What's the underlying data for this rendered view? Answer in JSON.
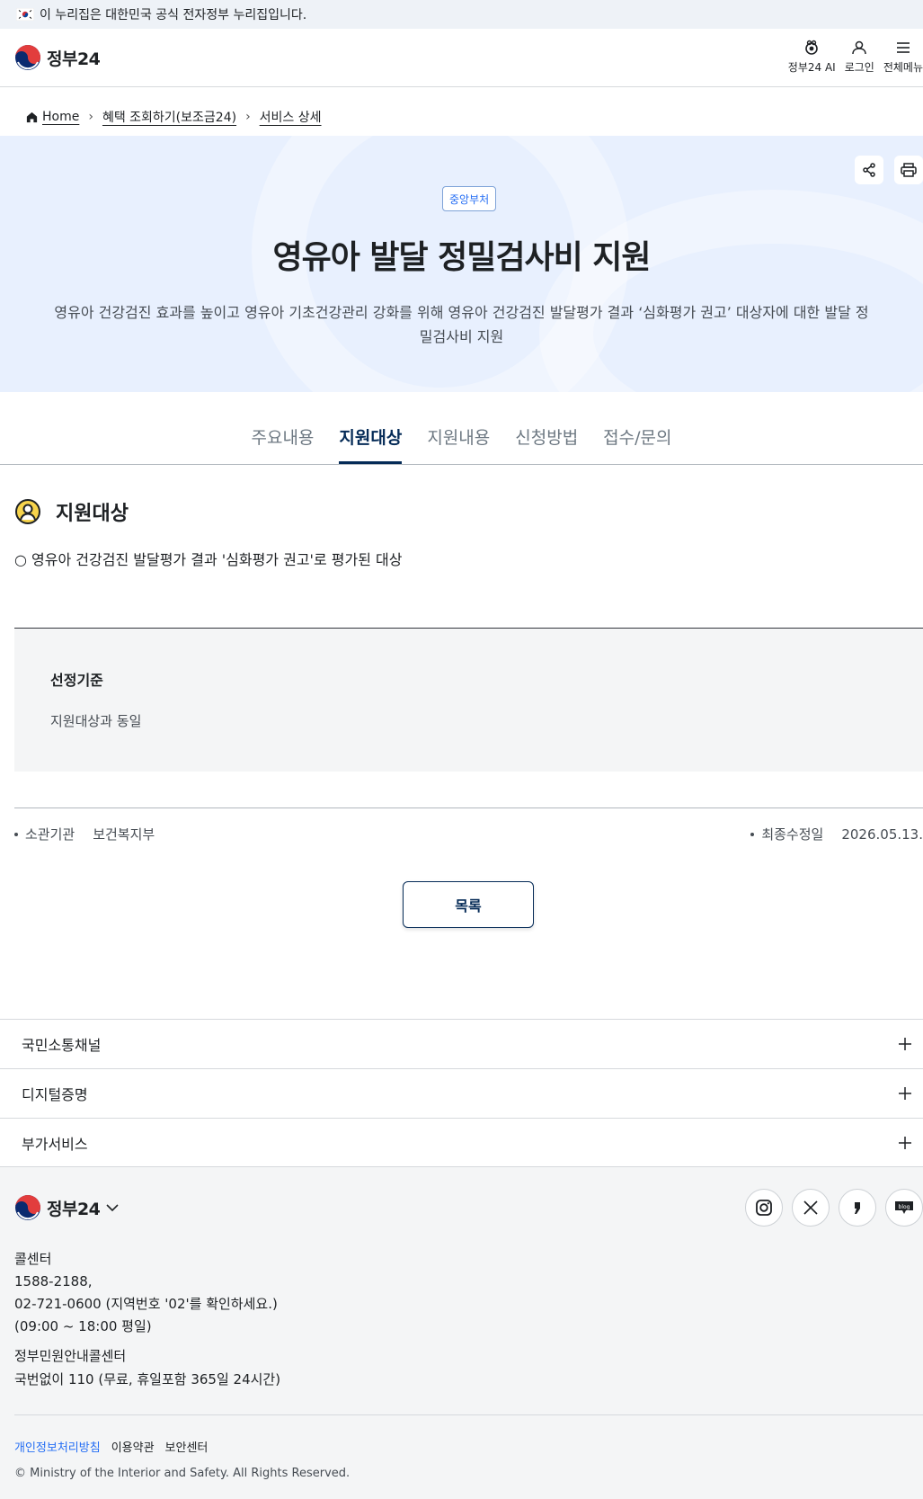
{
  "gov_banner": {
    "text": "이 누리집은 대한민국 공식 전자정부 누리집입니다."
  },
  "header": {
    "logo_text": "정부24",
    "utils": [
      {
        "label": "정부24 AI",
        "icon": "ai-icon"
      },
      {
        "label": "로그인",
        "icon": "user-icon"
      },
      {
        "label": "전체메뉴",
        "icon": "menu-icon"
      }
    ]
  },
  "breadcrumb": {
    "home": "Home",
    "level1": "혜택 조회하기(보조금24)",
    "level2": "서비스 상세"
  },
  "hero": {
    "badge": "중앙부처",
    "title": "영유아 발달 정밀검사비 지원",
    "description": "영유아 건강검진 효과를 높이고 영유아 기초건강관리 강화를 위해 영유아 건강검진 발달평가 결과 ‘심화평가 권고’ 대상자에 대한 발달 정밀검사비 지원",
    "share_icon": "share-icon",
    "print_icon": "print-icon"
  },
  "tabs": [
    {
      "label": "주요내용",
      "active": false
    },
    {
      "label": "지원대상",
      "active": true
    },
    {
      "label": "지원내용",
      "active": false
    },
    {
      "label": "신청방법",
      "active": false
    },
    {
      "label": "접수/문의",
      "active": false
    }
  ],
  "section": {
    "title": "지원대상",
    "body": "○ 영유아 건강검진 발달평가 결과 '심화평가 권고'로 평가된 대상"
  },
  "criteria": {
    "title": "선정기준",
    "text": "지원대상과 동일"
  },
  "meta": {
    "agency_label": "소관기관",
    "agency_value": "보건복지부",
    "updated_label": "최종수정일",
    "updated_value": "2026.05.13."
  },
  "list_button": "목록",
  "accordions": [
    "국민소통채널",
    "디지털증명",
    "부가서비스"
  ],
  "footer": {
    "logo_text": "정부24",
    "sns": [
      "instagram-icon",
      "x-icon",
      "kakao-icon",
      "blog-icon"
    ],
    "call_title": "콜센터",
    "call_line1": "1588-2188,",
    "call_line2": "02-721-0600 (지역번호 '02'를 확인하세요.)",
    "call_hours": "(09:00 ~ 18:00 평일)",
    "civil_title": "정부민원안내콜센터",
    "civil_text": "국번없이 110 (무료, 휴일포함 365일 24시간)",
    "links": [
      "개인정보처리방침",
      "이용약관",
      "보안센터"
    ],
    "copyright": "© Ministry of the Interior and Safety. All Rights Reserved."
  },
  "colors": {
    "primary_navy": "#052b57",
    "hero_bg": "#e8f0fe",
    "link_blue": "#256ef4",
    "footer_bg": "#f4f5f6"
  }
}
